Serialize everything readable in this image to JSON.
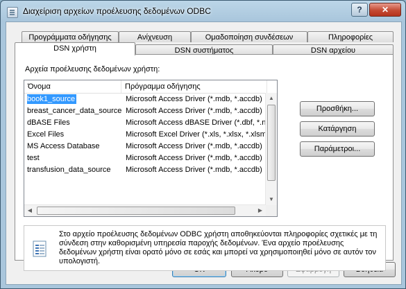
{
  "window": {
    "title": "Διαχείριση αρχείων προέλευσης δεδομένων ODBC",
    "help_label": "?",
    "close_label": "✕"
  },
  "tabs_back": [
    {
      "label": "Προγράμματα οδήγησης"
    },
    {
      "label": "Ανίχνευση"
    },
    {
      "label": "Ομαδοποίηση συνδέσεων"
    },
    {
      "label": "Πληροφορίες"
    }
  ],
  "tabs_front": [
    {
      "label": "DSN χρήστη"
    },
    {
      "label": "DSN συστήματος"
    },
    {
      "label": "DSN αρχείου"
    }
  ],
  "panel": {
    "section_label": "Αρχεία προέλευσης δεδομένων χρήστη:",
    "columns": [
      "Όνομα",
      "Πρόγραμμα οδήγησης"
    ],
    "rows": [
      {
        "name": "book1_source",
        "driver": "Microsoft Access Driver (*.mdb, *.accdb)"
      },
      {
        "name": "breast_cancer_data_source",
        "driver": "Microsoft Access Driver (*.mdb, *.accdb)"
      },
      {
        "name": "dBASE Files",
        "driver": "Microsoft Access dBASE Driver (*.dbf, *.nd"
      },
      {
        "name": "Excel Files",
        "driver": "Microsoft Excel Driver (*.xls, *.xlsx, *.xlsm, *"
      },
      {
        "name": "MS Access Database",
        "driver": "Microsoft Access Driver (*.mdb, *.accdb)"
      },
      {
        "name": "test",
        "driver": "Microsoft Access Driver (*.mdb, *.accdb)"
      },
      {
        "name": "transfusion_data_source",
        "driver": "Microsoft Access Driver (*.mdb, *.accdb)"
      }
    ],
    "selected_row": "book1_source",
    "buttons": {
      "add": "Προσθήκη...",
      "remove": "Κατάργηση",
      "configure": "Παράμετροι..."
    },
    "info": "Στο αρχείο προέλευσης δεδομένων ODBC χρήστη αποθηκεύονται πληροφορίες σχετικές με τη σύνδεση στην καθορισμένη υπηρεσία παροχής δεδομένων. Ένα αρχείο προέλευσης δεδομένων χρήστη είναι ορατό μόνο σε εσάς και μπορεί να χρησιμοποιηθεί μόνο σε αυτόν τον υπολογιστή."
  },
  "footer": {
    "ok": "OK",
    "cancel": "Άκυρο",
    "apply": "Εφαρμογή",
    "help": "Βοήθεια"
  },
  "icons": {
    "app": "datasource-icon",
    "info": "document-info-icon"
  },
  "colors": {
    "selection": "#3399ff",
    "default_button_border": "#3c7fb1"
  }
}
